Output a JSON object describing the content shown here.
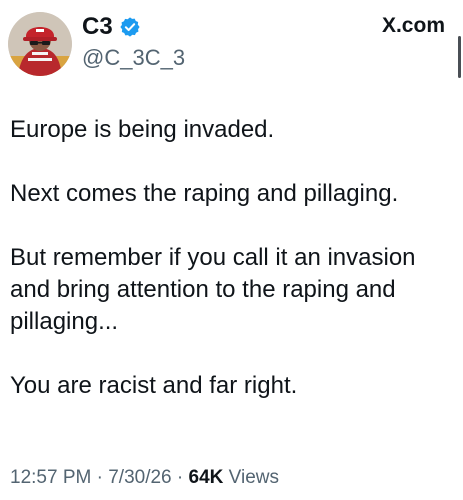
{
  "header": {
    "display_name": "C3",
    "handle": "@C_3C_3",
    "brand": "X.com",
    "verified_color": "#1d9bf0"
  },
  "tweet": {
    "paragraphs": [
      "Europe is being invaded.",
      "Next comes the raping and pillaging.",
      "But remember if you call it an invasion and bring attention to the raping and pillaging...",
      "You are racist and far right."
    ]
  },
  "meta": {
    "time": "12:57 PM",
    "separator": "·",
    "date": "7/30/26",
    "views_count": "64K",
    "views_label": "Views"
  },
  "icons": {
    "avatar": "profile-avatar",
    "verified": "verified-badge-icon"
  }
}
